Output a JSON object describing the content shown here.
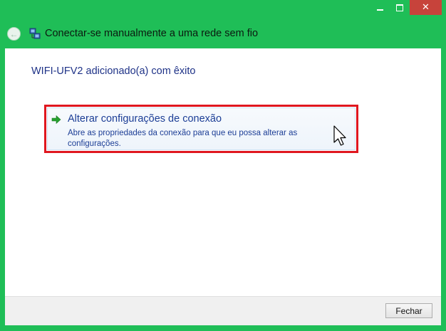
{
  "window": {
    "title": "Conectar-se manualmente a uma rede sem fio",
    "accent_color": "#1fbe57",
    "caption_buttons": {
      "minimize_icon": "minimize-icon",
      "maximize_icon": "maximize-icon",
      "close_icon": "close-icon",
      "close_symbol": "✕"
    }
  },
  "nav": {
    "back_icon": "back-arrow-icon",
    "back_symbol": "←",
    "network_icon": "network-adapter-icon"
  },
  "main": {
    "message": "WIFI-UFV2 adicionado(a) com êxito",
    "option": {
      "icon": "green-arrow-icon",
      "title": "Alterar configurações de conexão",
      "description": "Abre as propriedades da conexão para que eu possa alterar as configurações."
    }
  },
  "footer": {
    "close_label": "Fechar"
  },
  "highlight_color": "#e0171f"
}
